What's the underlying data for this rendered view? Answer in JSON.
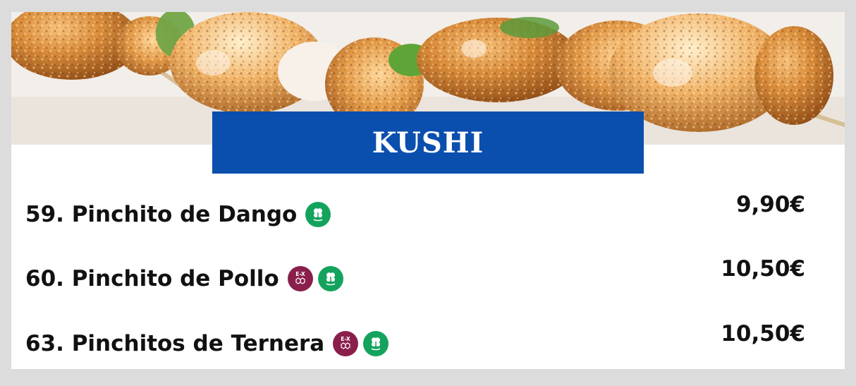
{
  "section": {
    "title": "KUSHI"
  },
  "items": [
    {
      "label": "59. Pinchito de Dango",
      "price": "9,90€",
      "badges": [
        "vegetal-icon"
      ]
    },
    {
      "label": "60. Pinchito de Pollo",
      "price": "10,50€",
      "badges": [
        "ex-allergen-icon",
        "vegetal-icon"
      ]
    },
    {
      "label": "63. Pinchitos de Ternera",
      "price": "10,50€",
      "badges": [
        "ex-allergen-icon",
        "vegetal-icon"
      ]
    }
  ],
  "badge_text": {
    "ex": "E-X"
  },
  "colors": {
    "banner": "#0b4fae",
    "vegetal_badge": "#14a35d",
    "ex_badge": "#8a1f4b"
  }
}
